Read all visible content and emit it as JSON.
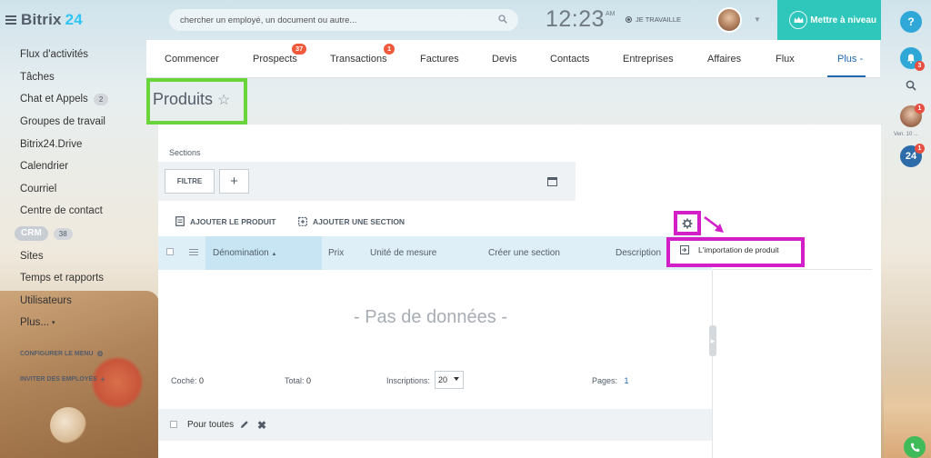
{
  "app": {
    "name": "Bitrix",
    "name_accent": "24"
  },
  "sidebar": {
    "items": [
      {
        "label": "Flux d'activités"
      },
      {
        "label": "Tâches"
      },
      {
        "label": "Chat et Appels",
        "badge": "2"
      },
      {
        "label": "Groupes de travail"
      },
      {
        "label": "Bitrix24.Drive"
      },
      {
        "label": "Calendrier"
      },
      {
        "label": "Courriel"
      },
      {
        "label": "Centre de contact"
      },
      {
        "label": "CRM",
        "badge": "38"
      },
      {
        "label": "Sites"
      },
      {
        "label": "Temps et rapports"
      },
      {
        "label": "Utilisateurs"
      },
      {
        "label": "Plus..."
      }
    ],
    "configure_menu": "CONFIGURER LE MENU",
    "invite_employees": "INVITER DES EMPLOYÉS"
  },
  "header": {
    "search_placeholder": "chercher un employé, un document ou autre...",
    "clock": "12:23",
    "ampm": "AM",
    "work_status": "JE TRAVAILLE",
    "upgrade_label": "Mettre à niveau"
  },
  "rightbar": {
    "help": "?",
    "bell_badge": "3",
    "user_badge": "1",
    "date_label": "Ven. 10 ...",
    "b24_label": "24",
    "b24_badge": "1"
  },
  "tabs": [
    {
      "label": "Commencer"
    },
    {
      "label": "Prospects",
      "badge": "37"
    },
    {
      "label": "Transactions",
      "badge": "1"
    },
    {
      "label": "Factures"
    },
    {
      "label": "Devis"
    },
    {
      "label": "Contacts"
    },
    {
      "label": "Entreprises"
    },
    {
      "label": "Affaires"
    },
    {
      "label": "Flux"
    },
    {
      "label": "Plus -",
      "active": true
    }
  ],
  "page": {
    "title": "Produits",
    "sections_label": "Sections",
    "filter_label": "FILTRE",
    "plus_label": "+",
    "add_product": "AJOUTER LE PRODUIT",
    "add_section": "AJOUTER UNE SECTION",
    "popup_item": "L'importation de produit",
    "no_data": "- Pas de données -"
  },
  "table": {
    "columns": [
      "Dénomination",
      "Prix",
      "Unité de mesure",
      "Créer une section",
      "Description"
    ],
    "sort_indicator": "▲"
  },
  "footer": {
    "checked_label": "Coché:",
    "checked_value": "0",
    "total_label": "Total:",
    "total_value": "0",
    "inscriptions_label": "Inscriptions:",
    "inscriptions_value": "20",
    "pages_label": "Pages:",
    "pages_value": "1",
    "for_all": "Pour toutes"
  },
  "colors": {
    "highlight_green": "#6ad43b",
    "highlight_magenta": "#d21fc7",
    "accent_blue": "#2067b0",
    "upgrade_teal": "#2fc6bb"
  }
}
